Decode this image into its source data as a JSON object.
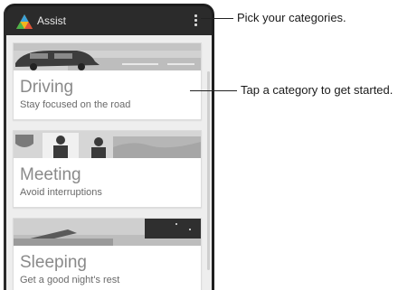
{
  "app": {
    "title": "Assist",
    "logo_icon": "assist-logo-icon",
    "menu_icon": "overflow-menu-icon"
  },
  "categories": [
    {
      "title": "Driving",
      "subtitle": "Stay focused on the road",
      "art": "driving-illustration"
    },
    {
      "title": "Meeting",
      "subtitle": "Avoid interruptions",
      "art": "meeting-illustration"
    },
    {
      "title": "Sleeping",
      "subtitle": "Get a good night's rest",
      "art": "sleeping-illustration"
    }
  ],
  "callouts": {
    "menu": "Pick your categories.",
    "category": "Tap a category to get started."
  },
  "colors": {
    "appbar": "#2b2b2b",
    "screen_bg": "#eeeeee",
    "card_title": "#8a8a8a"
  }
}
